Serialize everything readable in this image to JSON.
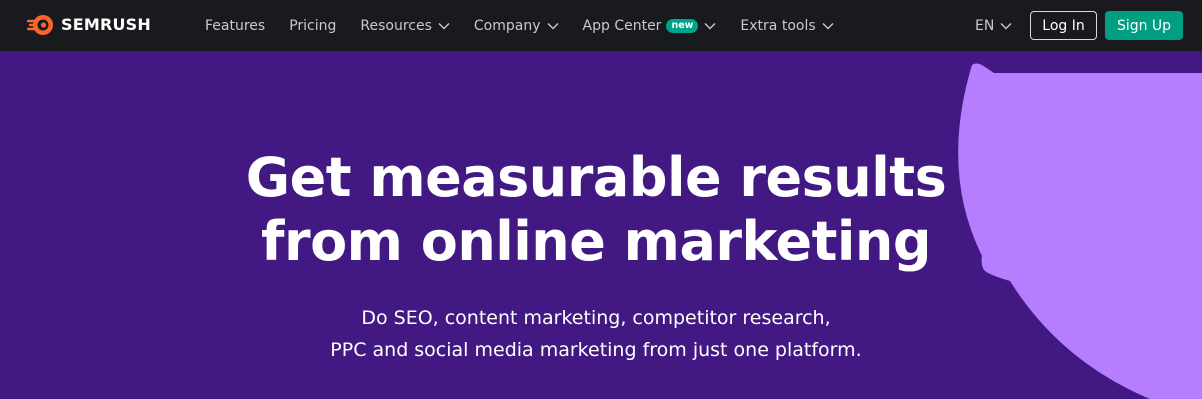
{
  "brand": {
    "name": "SEMRUSH",
    "logo_color": "#ff642d"
  },
  "nav": {
    "items": [
      {
        "label": "Features",
        "has_dropdown": false
      },
      {
        "label": "Pricing",
        "has_dropdown": false
      },
      {
        "label": "Resources",
        "has_dropdown": true
      },
      {
        "label": "Company",
        "has_dropdown": true
      },
      {
        "label": "App Center",
        "has_dropdown": true,
        "badge": "new"
      },
      {
        "label": "Extra tools",
        "has_dropdown": true
      }
    ]
  },
  "header": {
    "language": "EN",
    "login_label": "Log In",
    "signup_label": "Sign Up"
  },
  "hero": {
    "headline_line1": "Get measurable results",
    "headline_line2": "from online marketing",
    "sub_line1": "Do SEO, content marketing, competitor research,",
    "sub_line2": "PPC and social media marketing from just one platform."
  },
  "colors": {
    "topbar": "#181a1d",
    "hero_bg": "#421983",
    "accent_purple": "#b57eff",
    "signup_green": "#009f81",
    "badge_green": "#00a389"
  }
}
